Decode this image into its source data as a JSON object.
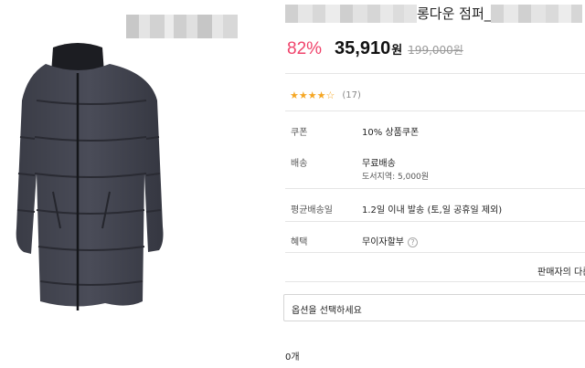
{
  "product": {
    "title_visible": "롱다운 점퍼_",
    "image_alt": "jacket",
    "image_icon": "long-padded-jacket"
  },
  "price": {
    "discount": "82%",
    "sale_price": "35,910",
    "currency": "원",
    "original_price": "199,000원"
  },
  "rating": {
    "stars": "★★★★☆",
    "review_count": "(17)"
  },
  "info": {
    "coupon_label": "쿠폰",
    "coupon_value": "10% 상품쿠폰",
    "delivery_label": "배송",
    "delivery_value": "무료배송",
    "delivery_extra": "도서지역: 5,000원",
    "avg_delivery_label": "평균배송일",
    "avg_delivery_value": "1.2일 이내 발송 (토,일 공휴일 제외)",
    "benefit_label": "혜택",
    "benefit_value": "무이자할부",
    "help_icon": "?"
  },
  "seller_link": "판매자의 다른",
  "option": {
    "placeholder": "옵션을 선택하세요"
  },
  "quantity": "0개",
  "colors": {
    "discount": "#f0436b",
    "star": "#f5a623"
  }
}
